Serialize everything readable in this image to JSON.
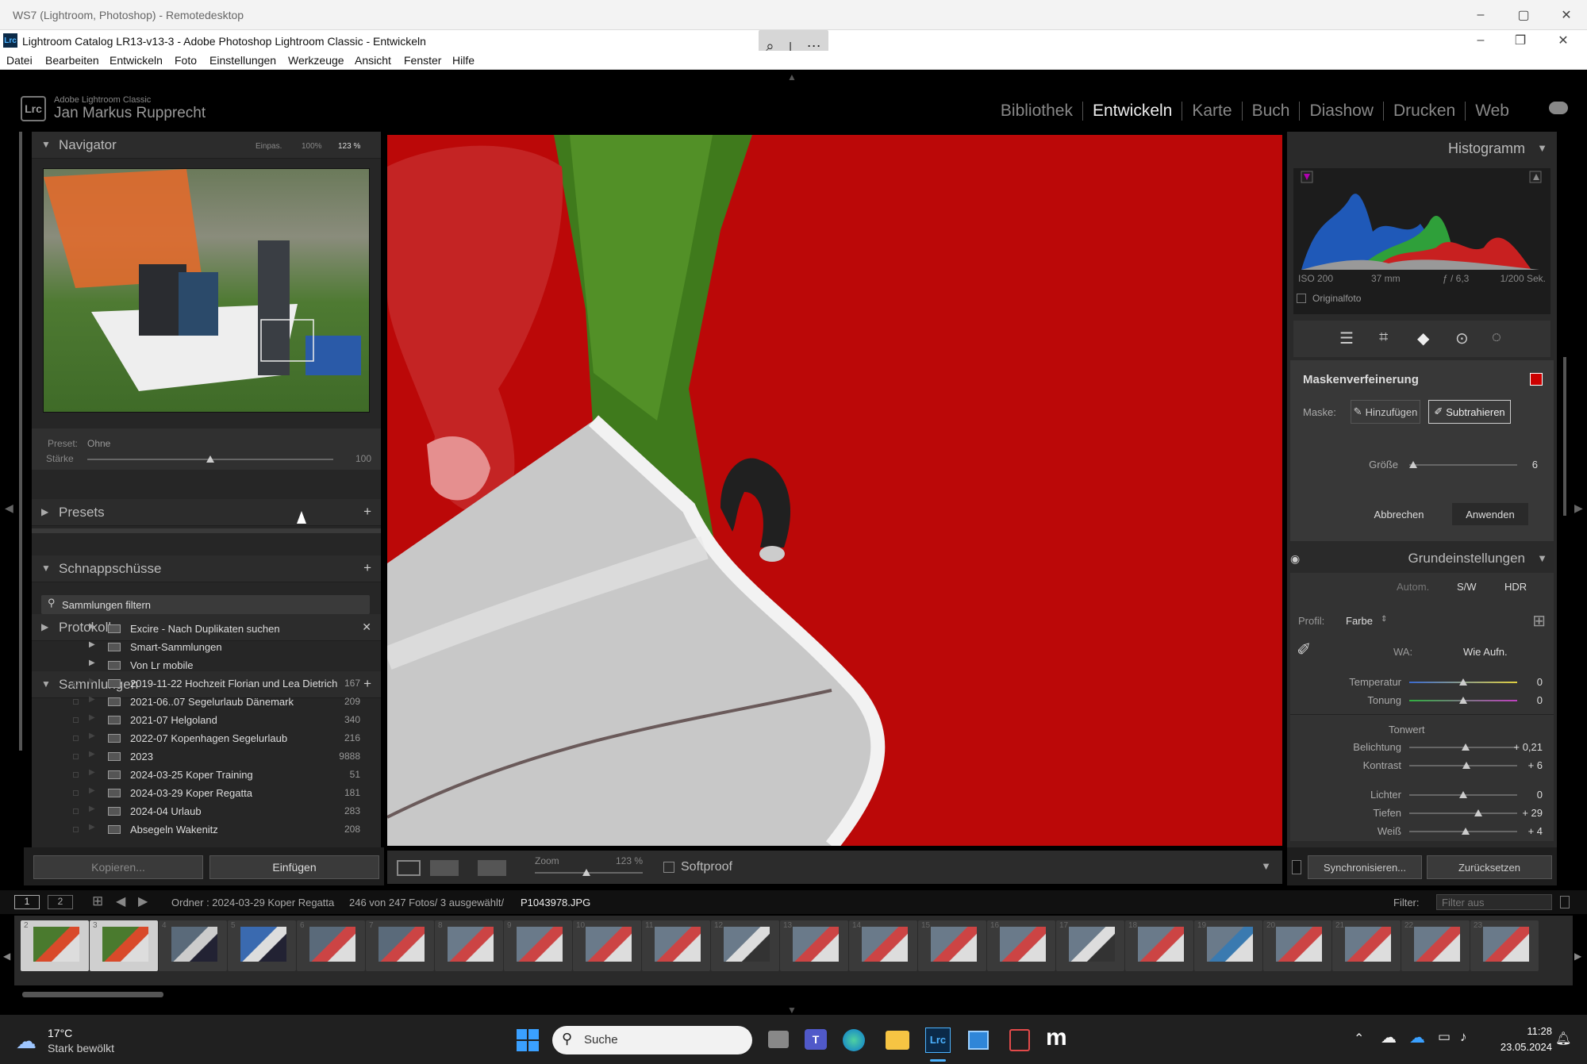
{
  "remote_window": {
    "title": "WS7 (Lightroom, Photoshop) - Remotedesktop"
  },
  "app_window": {
    "title": "Lightroom Catalog LR13-v13-3 - Adobe Photoshop Lightroom Classic - Entwickeln"
  },
  "menu": [
    "Datei",
    "Bearbeiten",
    "Entwickeln",
    "Foto",
    "Einstellungen",
    "Werkzeuge",
    "Ansicht",
    "Fenster",
    "Hilfe"
  ],
  "identity": {
    "product": "Adobe Lightroom Classic",
    "user": "Jan Markus Rupprecht",
    "logo": "Lrc"
  },
  "modules": [
    "Bibliothek",
    "Entwickeln",
    "Karte",
    "Buch",
    "Diashow",
    "Drucken",
    "Web"
  ],
  "active_module": "Entwickeln",
  "navigator": {
    "title": "Navigator",
    "fit": "Einpas.",
    "z100": "100%",
    "zoom": "123 %"
  },
  "preset_box": {
    "preset_label": "Preset:",
    "preset_value": "Ohne",
    "strength_label": "Stärke",
    "strength_value": "100",
    "strength": 0.5
  },
  "left_panels": {
    "presets": "Presets",
    "snapshots": "Schnappschüsse",
    "history": "Protokoll",
    "collections": "Sammlungen"
  },
  "collections_filter": "Sammlungen filtern",
  "collections": [
    {
      "name": "Excire - Nach Duplikaten suchen",
      "count": ""
    },
    {
      "name": "Smart-Sammlungen",
      "count": ""
    },
    {
      "name": "Von Lr mobile",
      "count": ""
    },
    {
      "name": "2019-11-22 Hochzeit Florian und Lea Dietrich",
      "count": "167"
    },
    {
      "name": "2021-06..07 Segelurlaub Dänemark",
      "count": "209"
    },
    {
      "name": "2021-07 Helgoland",
      "count": "340"
    },
    {
      "name": "2022-07 Kopenhagen Segelurlaub",
      "count": "216"
    },
    {
      "name": "2023",
      "count": "9888"
    },
    {
      "name": "2024-03-25 Koper Training",
      "count": "51"
    },
    {
      "name": "2024-03-29 Koper Regatta",
      "count": "181"
    },
    {
      "name": "2024-04 Urlaub",
      "count": "283"
    },
    {
      "name": "Absegeln Wakenitz",
      "count": "208"
    }
  ],
  "left_buttons": {
    "copy": "Kopieren...",
    "paste": "Einfügen"
  },
  "toolbar": {
    "zoom_label": "Zoom",
    "zoom_value": "123 %",
    "softproof": "Softproof"
  },
  "histogram": {
    "title": "Histogramm",
    "iso": "ISO 200",
    "focal": "37 mm",
    "aperture": "ƒ / 6,3",
    "shutter": "1/200 Sek.",
    "original": "Originalfoto"
  },
  "mask": {
    "title": "Maskenverfeinerung",
    "mask_label": "Maske:",
    "add": "Hinzufügen",
    "subtract": "Subtrahieren",
    "size_label": "Größe",
    "size_value": "6",
    "cancel": "Abbrechen",
    "apply": "Anwenden",
    "color": "#cc0000"
  },
  "basic": {
    "title": "Grundeinstellungen",
    "auto": "Autom.",
    "bw": "S/W",
    "hdr": "HDR",
    "profile_label": "Profil:",
    "profile_value": "Farbe",
    "wb_label": "WA:",
    "wb_value": "Wie Aufn.",
    "tone_label": "Tonwert",
    "sliders": [
      {
        "label": "Temperatur",
        "value": "0"
      },
      {
        "label": "Tonung",
        "value": "0"
      },
      {
        "label": "Belichtung",
        "value": "+ 0,21"
      },
      {
        "label": "Kontrast",
        "value": "+ 6"
      },
      {
        "label": "Lichter",
        "value": "0"
      },
      {
        "label": "Tiefen",
        "value": "+ 29"
      },
      {
        "label": "Weiß",
        "value": "+ 4"
      }
    ]
  },
  "right_buttons": {
    "sync": "Synchronisieren...",
    "reset": "Zurücksetzen"
  },
  "filmstrip_bar": {
    "v1": "1",
    "v2": "2",
    "folder": "Ordner : 2024-03-29 Koper Regatta",
    "count": "246 von 247 Fotos/ 3 ausgewählt/",
    "file": "P1043978.JPG",
    "filter_label": "Filter:",
    "filter_value": "Filter aus"
  },
  "filmstrip_numbers": [
    "2",
    "3",
    "4",
    "5",
    "6",
    "7",
    "8",
    "9",
    "10",
    "11",
    "12",
    "13",
    "14",
    "15",
    "16",
    "17",
    "18",
    "19",
    "20",
    "21",
    "22",
    "23"
  ],
  "taskbar": {
    "temp": "17°C",
    "weather": "Stark bewölkt",
    "search": "Suche",
    "time": "11:28",
    "date": "23.05.2024"
  }
}
